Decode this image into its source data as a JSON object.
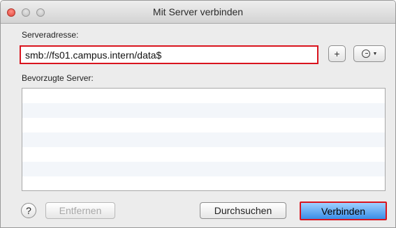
{
  "window": {
    "title": "Mit Server verbinden"
  },
  "address": {
    "label": "Serveradresse:",
    "value": "smb://fs01.campus.intern/data$"
  },
  "buttons": {
    "add_label": "+",
    "remove_label": "Entfernen",
    "browse_label": "Durchsuchen",
    "connect_label": "Verbinden",
    "help_label": "?"
  },
  "favorites": {
    "label": "Bevorzugte Server:",
    "items": []
  },
  "icons": {
    "close": "close-icon",
    "minimize": "minimize-icon",
    "zoom": "zoom-icon",
    "recent": "clock-icon",
    "dropdown": "chevron-down-icon"
  },
  "colors": {
    "highlight": "#d9141e",
    "default_button": "#3a8ee8"
  }
}
